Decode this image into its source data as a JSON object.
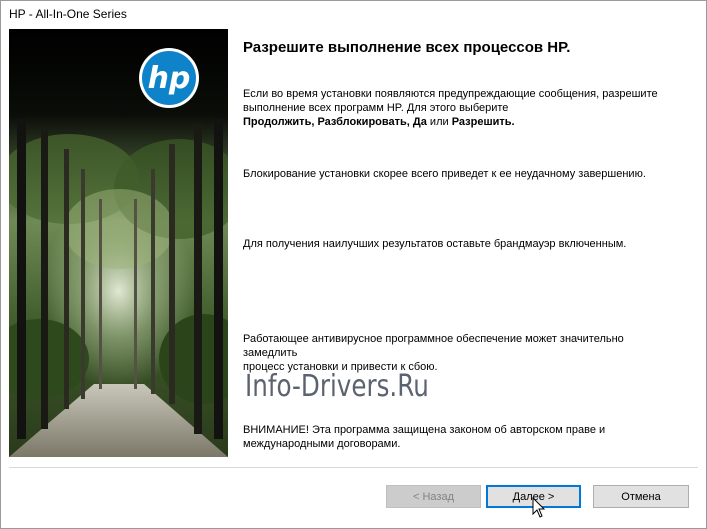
{
  "window": {
    "title": "HP - All-In-One Series"
  },
  "banner": {
    "logo_text": "hp"
  },
  "content": {
    "heading": "Разрешите выполнение всех процессов HP.",
    "p1_line1": "Если во время установки появляются предупреждающие сообщения, разрешите",
    "p1_line2": "выполнение всех программ HP. Для этого выберите",
    "p1_opt1": "Продолжить",
    "p1_opt2": "Разблокировать",
    "p1_opt3": "Да",
    "p1_or": "или",
    "p1_opt4": "Разрешить",
    "p2": "Блокирование установки скорее всего приведет к ее неудачному завершению.",
    "p3": "Для получения наилучших результатов оставьте брандмауэр включенным.",
    "p4_line1": "Работающее антивирусное программное обеспечение может значительно замедлить",
    "p4_line2": "процесс установки и привести к сбою.",
    "p5_line1": "ВНИМАНИЕ! Эта программа защищена законом об авторском праве и",
    "p5_line2": "международными договорами."
  },
  "watermark": "Info-Drivers.Ru",
  "buttons": {
    "back": "< Назад",
    "next": "Далее >",
    "cancel": "Отмена"
  }
}
